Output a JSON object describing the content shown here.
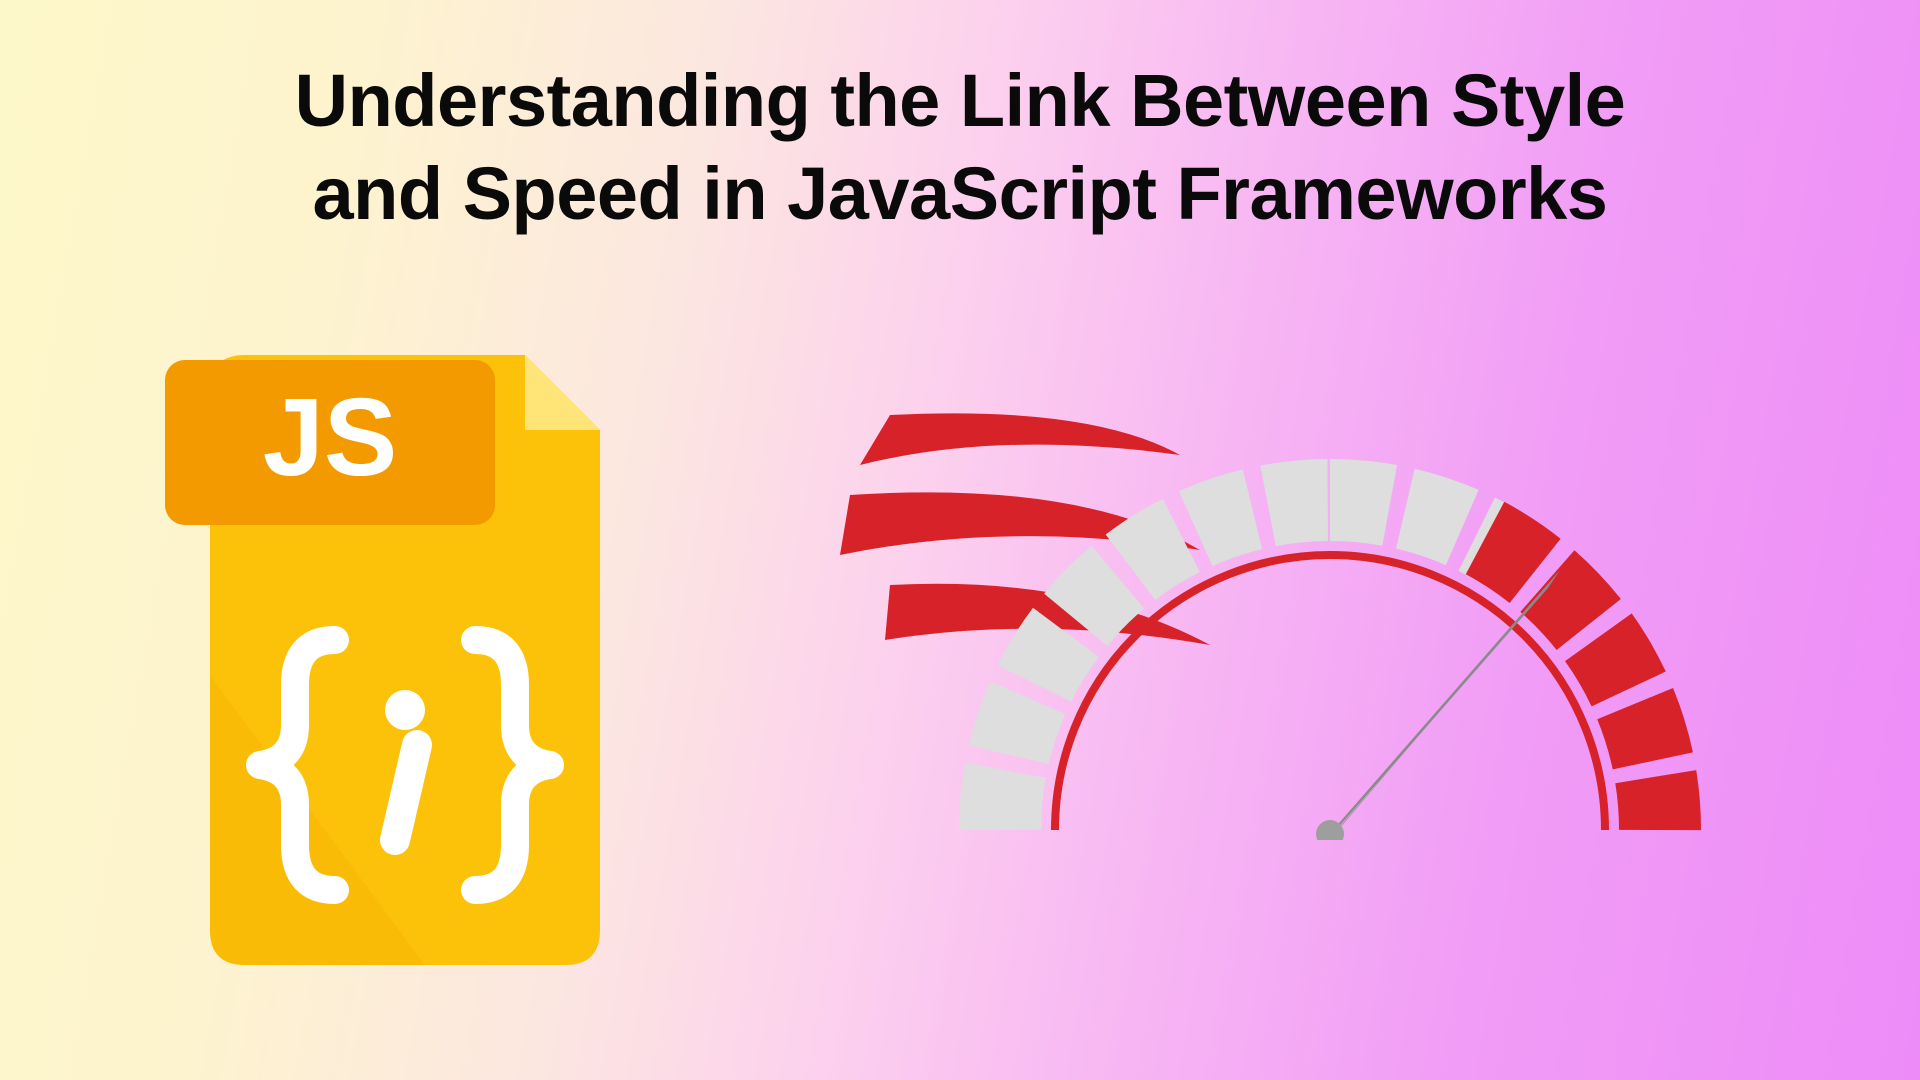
{
  "title_line1": "Understanding the Link Between Style",
  "title_line2": "and Speed in JavaScript Frameworks",
  "js_label": "JS",
  "colors": {
    "js_orange_dark": "#f29a00",
    "js_orange_light": "#fcc20a",
    "js_yellow": "#ffd43b",
    "white": "#ffffff",
    "gauge_red": "#d8222a",
    "gauge_grey": "#d9d9d9",
    "gauge_needle": "#9e9e9e"
  }
}
